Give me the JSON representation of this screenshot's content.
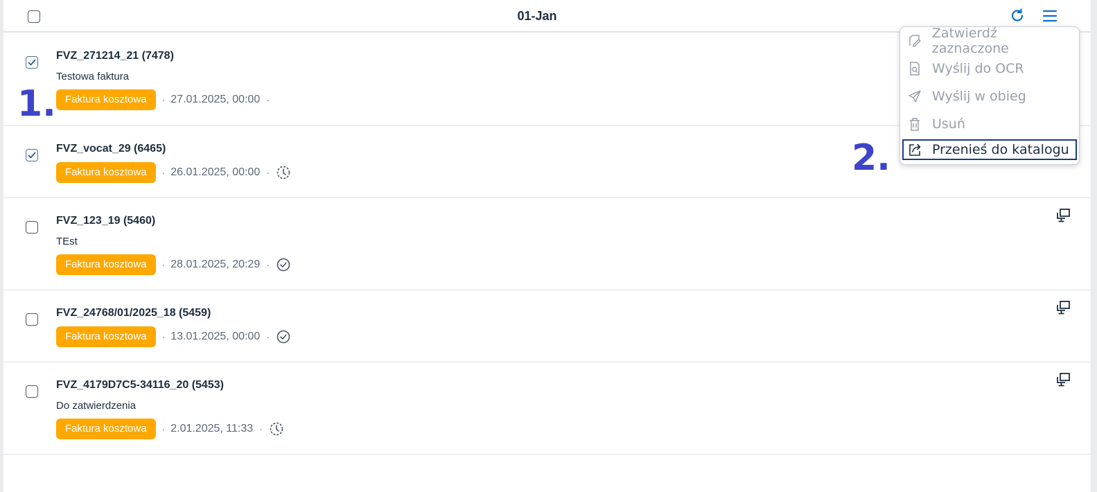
{
  "header": {
    "title": "01-Jan"
  },
  "annotations": {
    "one": "1.",
    "two": "2."
  },
  "rows": [
    {
      "title": "FVZ_271214_21 (7478)",
      "description": "Testowa faktura",
      "badge": "Faktura kosztowa",
      "date": "27.01.2025, 00:00",
      "checked": true,
      "status_icon": "none"
    },
    {
      "title": "FVZ_vocat_29 (6465)",
      "description": "",
      "badge": "Faktura kosztowa",
      "date": "26.01.2025, 00:00",
      "checked": true,
      "status_icon": "pending-clock-icon"
    },
    {
      "title": "FVZ_123_19 (5460)",
      "description": "TEst",
      "badge": "Faktura kosztowa",
      "date": "28.01.2025, 20:29",
      "checked": false,
      "status_icon": "approved-check-icon"
    },
    {
      "title": "FVZ_24768/01/2025_18 (5459)",
      "description": "",
      "badge": "Faktura kosztowa",
      "date": "13.01.2025, 00:00",
      "checked": false,
      "status_icon": "approved-check-icon"
    },
    {
      "title": "FVZ_4179D7C5-34116_20 (5453)",
      "description": "Do zatwierdzenia",
      "badge": "Faktura kosztowa",
      "date": "2.01.2025, 11:33",
      "checked": false,
      "status_icon": "pending-clock-icon"
    }
  ],
  "menu": {
    "items": [
      {
        "label": "Zatwierdź zaznaczone",
        "icon": "approve-edit-icon",
        "enabled": false
      },
      {
        "label": "Wyślij do OCR",
        "icon": "ocr-document-icon",
        "enabled": false
      },
      {
        "label": "Wyślij w obieg",
        "icon": "send-paper-plane-icon",
        "enabled": false
      },
      {
        "label": "Usuń",
        "icon": "trash-icon",
        "enabled": false
      },
      {
        "label": "Przenieś do katalogu",
        "icon": "move-to-folder-icon",
        "enabled": true
      }
    ]
  },
  "colors": {
    "badge": "#ffa800",
    "accent": "#0a6ed1",
    "annotation": "#3d44c9"
  }
}
